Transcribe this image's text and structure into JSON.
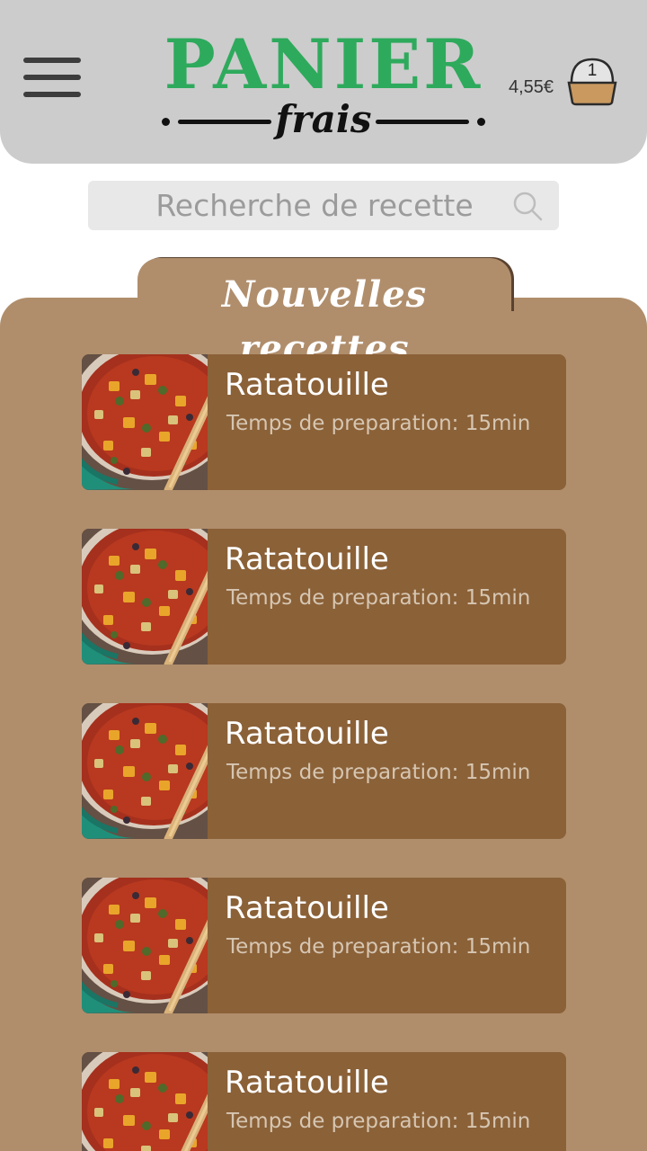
{
  "header": {
    "logo_main": "PANIER",
    "logo_sub": "frais",
    "cart_price": "4,55€",
    "basket_count": "1"
  },
  "search": {
    "placeholder": "Recherche de recette"
  },
  "section": {
    "title": "Nouvelles recettes"
  },
  "recipes": [
    {
      "title": "Ratatouille",
      "prep": "Temps de preparation: 15min"
    },
    {
      "title": "Ratatouille",
      "prep": "Temps de preparation: 15min"
    },
    {
      "title": "Ratatouille",
      "prep": "Temps de preparation: 15min"
    },
    {
      "title": "Ratatouille",
      "prep": "Temps de preparation: 15min"
    },
    {
      "title": "Ratatouille",
      "prep": "Temps de preparation: 15min"
    }
  ],
  "colors": {
    "brand_green": "#2eaa5c",
    "header_bg": "#cccccc",
    "section_bg": "#b08e6c",
    "card_bg": "#8b6138"
  }
}
